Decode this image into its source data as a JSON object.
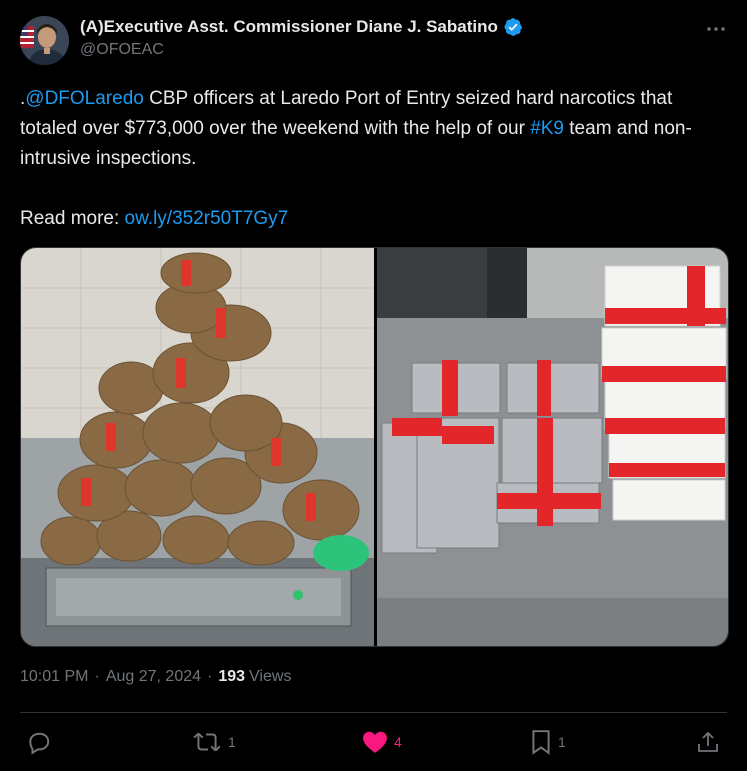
{
  "author": {
    "display_name": "(A)Executive Asst. Commissioner Diane J. Sabatino",
    "handle": "@OFOEAC",
    "verified": true,
    "verified_color": "#1d9bf0"
  },
  "post": {
    "prefix": ".",
    "mention": "@DFOLaredo",
    "text_part1": " CBP officers at Laredo Port of Entry seized hard narcotics that totaled over $773,000 over the weekend with the help of our ",
    "hashtag": "#K9",
    "text_part2": " team and non-intrusive inspections.",
    "read_more_label": "Read more: ",
    "read_more_link": "ow.ly/352r50T7Gy7"
  },
  "meta": {
    "time": "10:01 PM",
    "date": "Aug 27, 2024",
    "views_count": "193",
    "views_label": "Views",
    "separator": "·"
  },
  "actions": {
    "reply_count": "",
    "repost_count": "1",
    "like_count": "4",
    "bookmark_count": "1"
  },
  "colors": {
    "background": "#000000",
    "text": "#e7e9ea",
    "muted": "#71767b",
    "link": "#1d9bf0",
    "like": "#f91880"
  },
  "icons": [
    "verified-badge-icon",
    "more-icon",
    "reply-icon",
    "repost-icon",
    "heart-icon",
    "bookmark-icon",
    "share-icon"
  ]
}
